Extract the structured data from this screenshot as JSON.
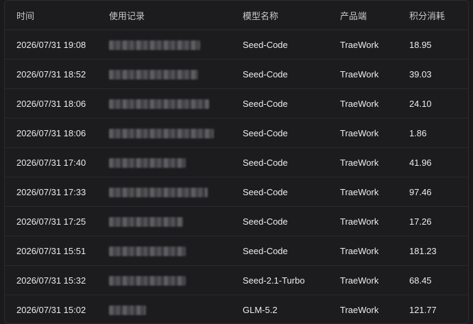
{
  "table": {
    "headers": {
      "time": "时间",
      "record": "使用记录",
      "model": "模型名称",
      "product": "产品端",
      "points": "积分消耗"
    },
    "rows": [
      {
        "time": "2026/07/31 19:08",
        "record_blur_width": 0.74,
        "model": "Seed-Code",
        "product": "TraeWork",
        "points": "18.95"
      },
      {
        "time": "2026/07/31 18:52",
        "record_blur_width": 0.72,
        "model": "Seed-Code",
        "product": "TraeWork",
        "points": "39.03"
      },
      {
        "time": "2026/07/31 18:06",
        "record_blur_width": 0.81,
        "model": "Seed-Code",
        "product": "TraeWork",
        "points": "24.10"
      },
      {
        "time": "2026/07/31 18:06",
        "record_blur_width": 0.85,
        "model": "Seed-Code",
        "product": "TraeWork",
        "points": "1.86"
      },
      {
        "time": "2026/07/31 17:40",
        "record_blur_width": 0.62,
        "model": "Seed-Code",
        "product": "TraeWork",
        "points": "41.96"
      },
      {
        "time": "2026/07/31 17:33",
        "record_blur_width": 0.8,
        "model": "Seed-Code",
        "product": "TraeWork",
        "points": "97.46"
      },
      {
        "time": "2026/07/31 17:25",
        "record_blur_width": 0.6,
        "model": "Seed-Code",
        "product": "TraeWork",
        "points": "17.26"
      },
      {
        "time": "2026/07/31 15:51",
        "record_blur_width": 0.62,
        "model": "Seed-Code",
        "product": "TraeWork",
        "points": "181.23"
      },
      {
        "time": "2026/07/31 15:32",
        "record_blur_width": 0.62,
        "model": "Seed-2.1-Turbo",
        "product": "TraeWork",
        "points": "68.45"
      },
      {
        "time": "2026/07/31 15:02",
        "record_blur_width": 0.3,
        "model": "GLM-5.2",
        "product": "TraeWork",
        "points": "121.77"
      }
    ]
  }
}
